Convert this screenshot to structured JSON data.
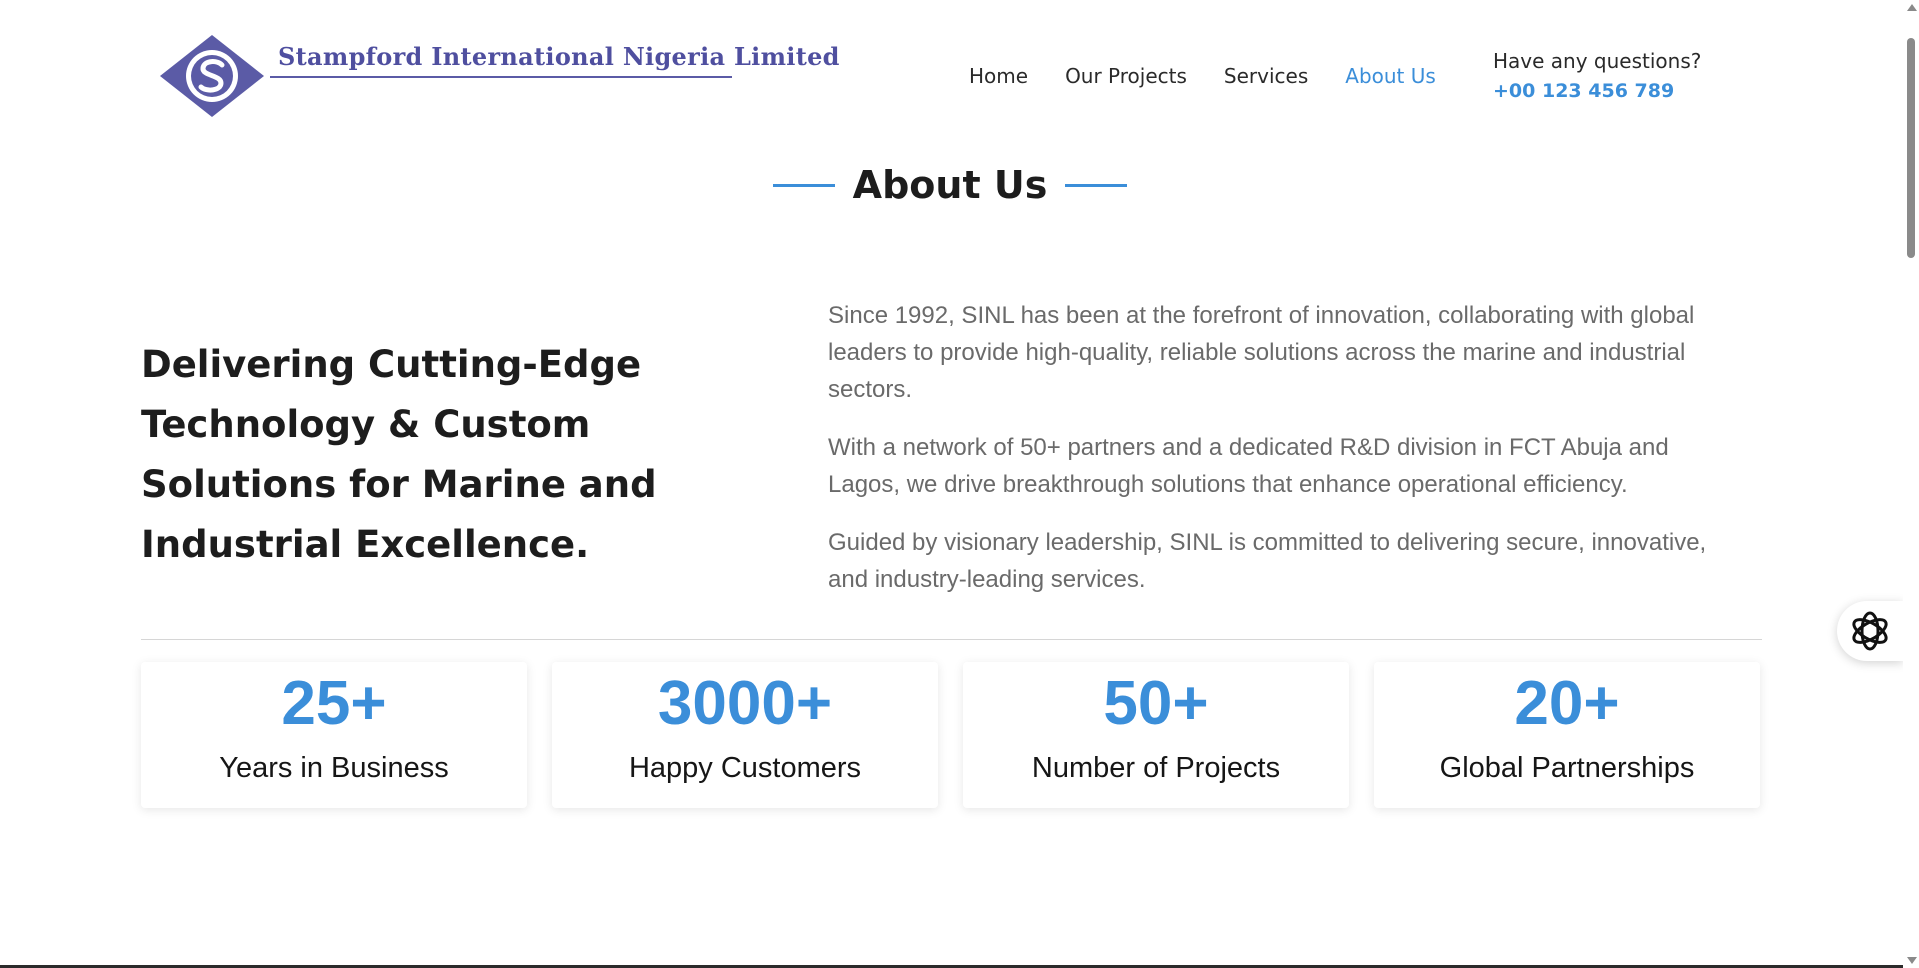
{
  "header": {
    "logo_text": "Stampford International Nigeria Limited",
    "logo_color": "#4f4f9f",
    "nav": [
      {
        "label": "Home"
      },
      {
        "label": "Our Projects"
      },
      {
        "label": "Services"
      },
      {
        "label": "About Us"
      }
    ],
    "active_nav": "About Us",
    "contact_question": "Have any questions?",
    "contact_phone": "+00 123 456 789"
  },
  "about": {
    "title": "About Us",
    "lead": "Delivering Cutting-Edge Technology & Custom Solutions for Marine and Industrial Excellence.",
    "paragraphs": [
      "Since 1992, SINL has been at the forefront of innovation, collaborating with global leaders to provide high-quality, reliable solutions across the marine and industrial sectors.",
      "With a network of 50+ partners and a dedicated R&D division in FCT Abuja and Lagos, we drive breakthrough solutions that enhance operational efficiency.",
      "Guided by visionary leadership, SINL is committed to delivering secure, innovative, and industry-leading services."
    ]
  },
  "stats": [
    {
      "value": "25+",
      "label": "Years in Business"
    },
    {
      "value": "3000+",
      "label": "Happy Customers"
    },
    {
      "value": "50+",
      "label": "Number of Projects"
    },
    {
      "value": "20+",
      "label": "Global Partnerships"
    }
  ],
  "widget": {
    "icon": "chat-assistant-icon"
  },
  "colors": {
    "accent": "#3b8ed9",
    "heading": "#1d1d1d",
    "body": "#6a6a6a"
  }
}
